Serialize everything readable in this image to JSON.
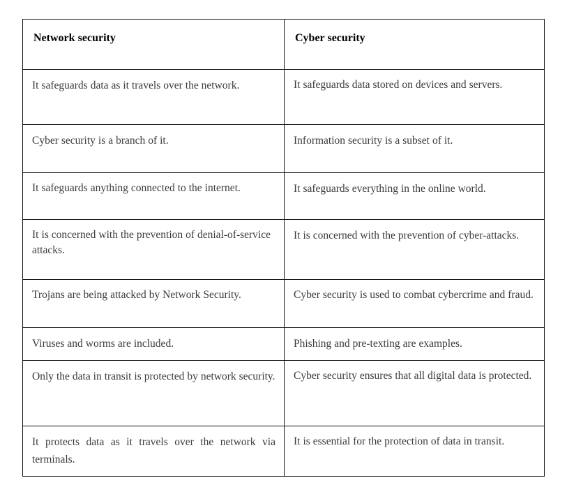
{
  "document": {
    "title": "Network security vs Cyber security comparison table"
  },
  "table": {
    "headers": [
      "Network security",
      "Cyber security"
    ],
    "rows": [
      {
        "left": "It safeguards data as it travels over the network.",
        "right": "It safeguards data stored on devices and servers.",
        "left_align": "justify",
        "right_align": "left"
      },
      {
        "left": "Cyber security is a branch of it.",
        "right": "Information security is a subset of it.",
        "left_align": "left",
        "right_align": "left"
      },
      {
        "left": "It safeguards anything connected to the internet.",
        "right": "It safeguards everything in the online world.",
        "left_align": "left",
        "right_align": "left"
      },
      {
        "left": "It is concerned with the prevention of denial-of-service attacks.",
        "right": "It is concerned with the prevention of cyber-attacks.",
        "left_align": "left",
        "right_align": "justify"
      },
      {
        "left": "Trojans are being attacked by Network Security.",
        "right": "Cyber security is used to combat cybercrime and fraud.",
        "left_align": "left",
        "right_align": "left"
      },
      {
        "left": "Viruses and worms are included.",
        "right": "Phishing and pre-texting are examples.",
        "left_align": "left",
        "right_align": "left"
      },
      {
        "left": "Only the data in transit is protected by network security.",
        "right": "Cyber security ensures that all digital data is protected.",
        "left_align": "justify",
        "right_align": "left"
      },
      {
        "left": "It protects data as it travels over the network via terminals.",
        "right": "It is essential for the protection of data in transit.",
        "left_align": "justify",
        "right_align": "left"
      }
    ]
  },
  "colors": {
    "border": "#111111",
    "header_text": "#000000",
    "body_text": "#3b3b3b",
    "background": "#ffffff"
  }
}
